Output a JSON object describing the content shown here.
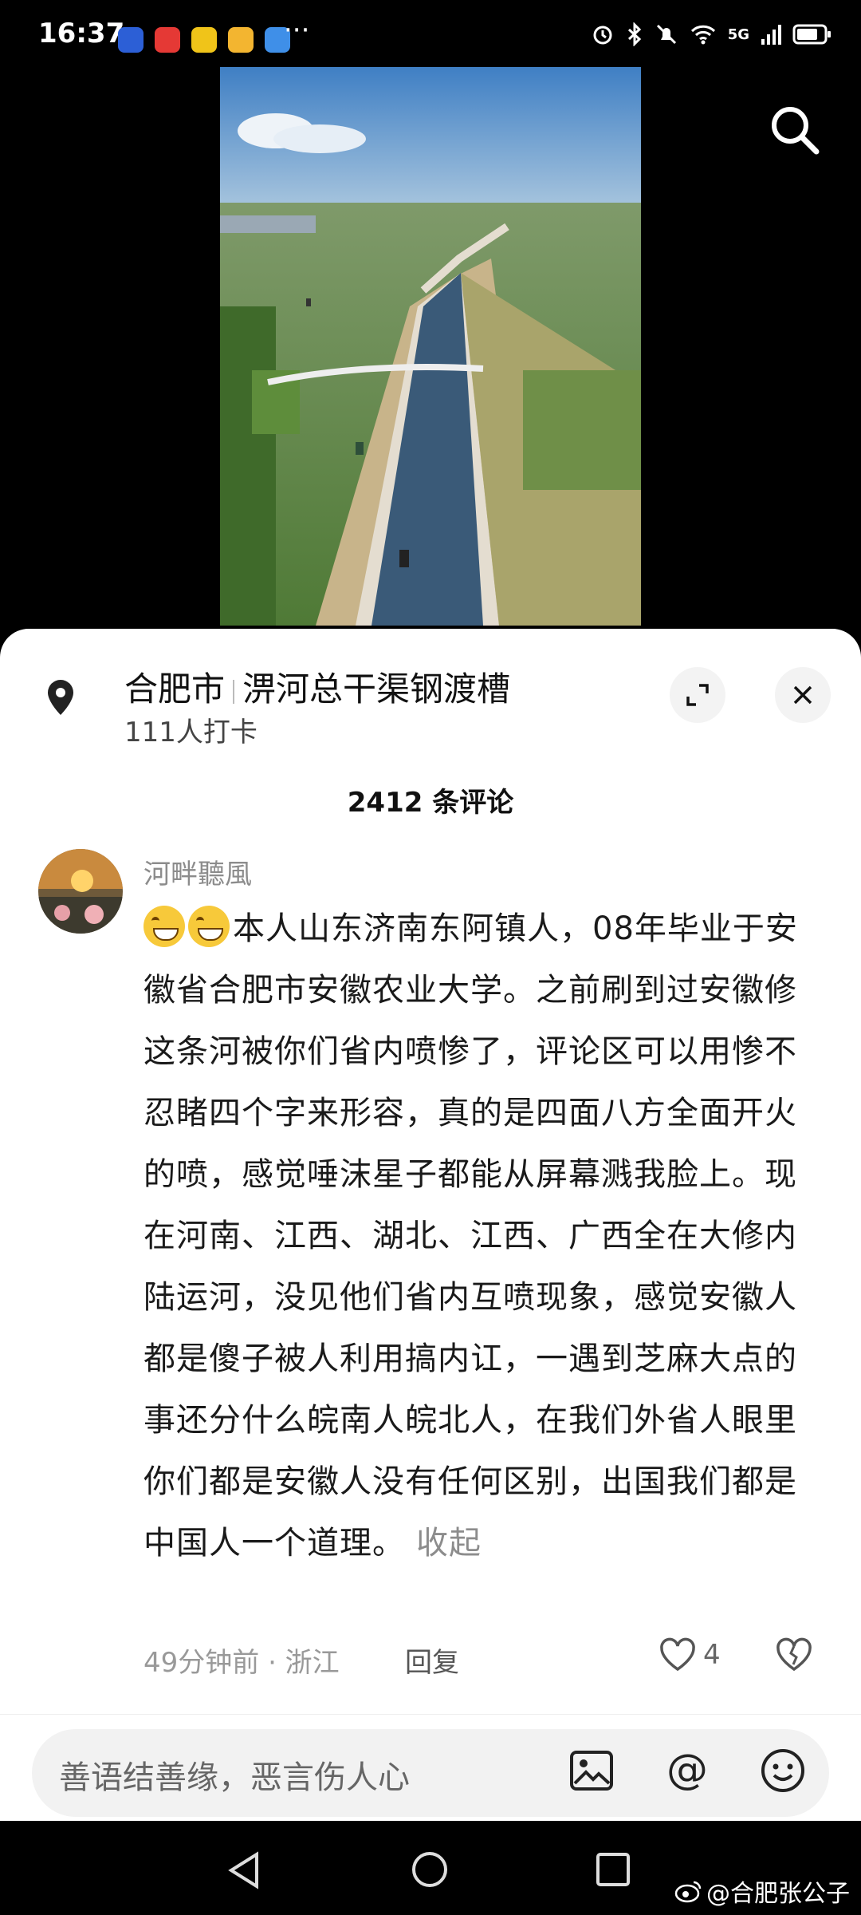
{
  "status_bar": {
    "time": "16:37",
    "more": "···",
    "network": "5G",
    "app_icon_colors": [
      "#2c5fd6",
      "#e53935",
      "#f0c419",
      "#f3b530",
      "#3f8fe8"
    ]
  },
  "location": {
    "city": "合肥市",
    "place": "淠河总干渠钢渡槽",
    "checkins": "111人打卡"
  },
  "comments": {
    "count_label": "2412 条评论",
    "items": [
      {
        "username": "河畔聽風",
        "text": "本人山东济南东阿镇人，08年毕业于安徽省合肥市安徽农业大学。之前刷到过安徽修这条河被你们省内喷惨了，评论区可以用惨不忍睹四个字来形容，真的是四面八方全面开火的喷，感觉唾沫星子都能从屏幕溅我脸上。现在河南、江西、湖北、江西、广西全在大修内陆运河，没见他们省内互喷现象，感觉安徽人都是傻子被人利用搞内讧，一遇到芝麻大点的事还分什么皖南人皖北人，在我们外省人眼里你们都是安徽人没有任何区别，出国我们都是中国人一个道理。",
        "collapse_label": "收起",
        "meta": "49分钟前 · 浙江",
        "reply_label": "回复",
        "likes": "4"
      }
    ]
  },
  "input": {
    "placeholder": "善语结善缘，恶言伤人心"
  },
  "watermark": "@合肥张公子"
}
